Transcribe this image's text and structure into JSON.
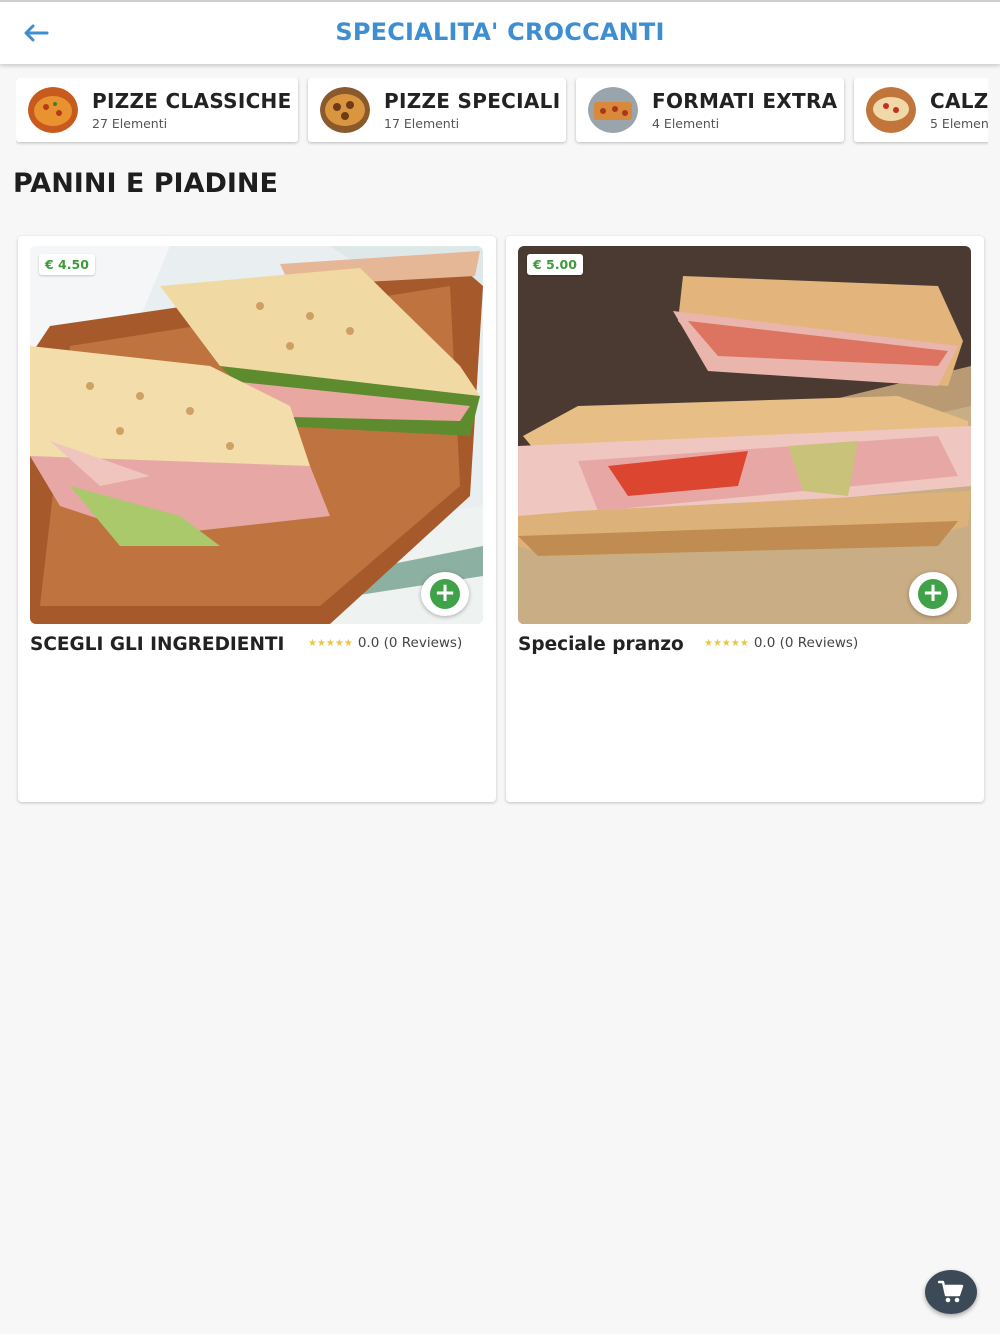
{
  "header": {
    "title": "SPECIALITA' CROCCANTI",
    "back_icon": "arrow-left-icon",
    "accent_color": "#3d8fd1"
  },
  "categories": [
    {
      "title": "PIZZE CLASSICHE",
      "count": "27 Elementi"
    },
    {
      "title": "PIZZE SPECIALI",
      "count": "17 Elementi"
    },
    {
      "title": "FORMATI EXTRA",
      "count": "4 Elementi"
    },
    {
      "title": "CALZ",
      "count": "5 Element"
    }
  ],
  "section": {
    "title": "PANINI E PIADINE"
  },
  "products": [
    {
      "name": "SCEGLI GLI INGREDIENTI",
      "price": "€ 4.50",
      "rating": "0.0",
      "reviews": "(0 Reviews)",
      "stars": "★★★★★",
      "add_icon": "plus-circle-icon"
    },
    {
      "name": "Speciale pranzo",
      "price": "€ 5.00",
      "rating": "0.0",
      "reviews": "(0 Reviews)",
      "stars": "★★★★★",
      "add_icon": "plus-circle-icon"
    }
  ],
  "cart": {
    "icon": "shopping-cart-icon"
  },
  "colors": {
    "price_green": "#3f9a3c",
    "add_green": "#3fa148",
    "cart_fab": "#3c4a57"
  }
}
